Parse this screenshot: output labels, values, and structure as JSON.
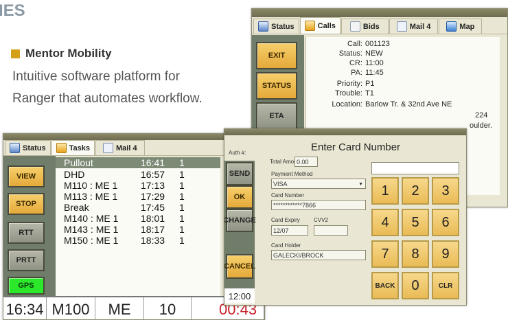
{
  "heading": "IES",
  "product": {
    "name": "Mentor Mobility",
    "description_lines": [
      "Intuitive software platform for",
      "Ranger that automates workflow."
    ]
  },
  "colors": {
    "accent_gold": "#d4a017",
    "gps_green": "#2be82b",
    "alert_red": "#c8202a"
  },
  "calls_window": {
    "tabs": [
      {
        "label": "Status",
        "icon": "status-icon"
      },
      {
        "label": "Calls",
        "icon": "calls-icon"
      },
      {
        "label": "Bids",
        "icon": "bids-icon"
      },
      {
        "label": "Mail 4",
        "icon": "mail-icon"
      },
      {
        "label": "Map",
        "icon": "map-icon"
      }
    ],
    "buttons": [
      "EXIT",
      "STATUS",
      "ETA"
    ],
    "fields": [
      {
        "key": "Call:",
        "value": "001123"
      },
      {
        "key": "Status:",
        "value": "NEW"
      },
      {
        "key": "CR:",
        "value": "11:00"
      },
      {
        "key": "PA:",
        "value": "11:45"
      },
      {
        "key": "Priority:",
        "value": "P1"
      },
      {
        "key": "Trouble:",
        "value": "T1"
      },
      {
        "key": "Location:",
        "value": "Barlow Tr. & 32nd Ave NE"
      }
    ],
    "partial_lines": [
      "224",
      "oulder."
    ]
  },
  "tasks_window": {
    "tabs": [
      {
        "label": "Status",
        "icon": "status-icon"
      },
      {
        "label": "Tasks",
        "icon": "tasks-icon"
      },
      {
        "label": "Mail 4",
        "icon": "mail-icon"
      }
    ],
    "buttons": [
      "VIEW",
      "STOP",
      "RTT",
      "PRTT",
      "GPS"
    ],
    "tasks": [
      {
        "name": "Pullout",
        "time": "16:41",
        "extra": "1"
      },
      {
        "name": "DHD",
        "time": "16:57",
        "extra": "1"
      },
      {
        "name": "M110 : ME 1",
        "time": "17:13",
        "extra": "1"
      },
      {
        "name": "M113 : ME 1",
        "time": "17:29",
        "extra": "1"
      },
      {
        "name": "Break",
        "time": "17:45",
        "extra": "1"
      },
      {
        "name": "M140 : ME 1",
        "time": "18:01",
        "extra": "1"
      },
      {
        "name": "M143 : ME 1",
        "time": "18:17",
        "extra": "1"
      },
      {
        "name": "M150 : ME 1",
        "time": "18:33",
        "extra": "1"
      }
    ],
    "status_bar": {
      "time": "16:34",
      "unit": "M100",
      "code": "ME",
      "count": "10",
      "timer": "00:43"
    }
  },
  "card_window": {
    "auth_label": "Auth #:",
    "title": "Enter Card Number",
    "buttons": [
      "SEND",
      "OK",
      "CHANGE",
      "CANCEL"
    ],
    "clock": "12:00",
    "total_amount_label": "Total Amount",
    "total_amount": "0.00",
    "payment_method_label": "Payment Method",
    "payment_method": "VISA",
    "card_number_label": "Card Number",
    "card_number": "************7866",
    "expiry_label": "Card Expiry",
    "cvv_label": "CVV2",
    "expiry": "12/07",
    "cvv": "",
    "holder_label": "Card Holder",
    "holder": "GALECKI/BROCK",
    "keypad": [
      "1",
      "2",
      "3",
      "4",
      "5",
      "6",
      "7",
      "8",
      "9",
      "BACK",
      "0",
      "CLR"
    ]
  }
}
